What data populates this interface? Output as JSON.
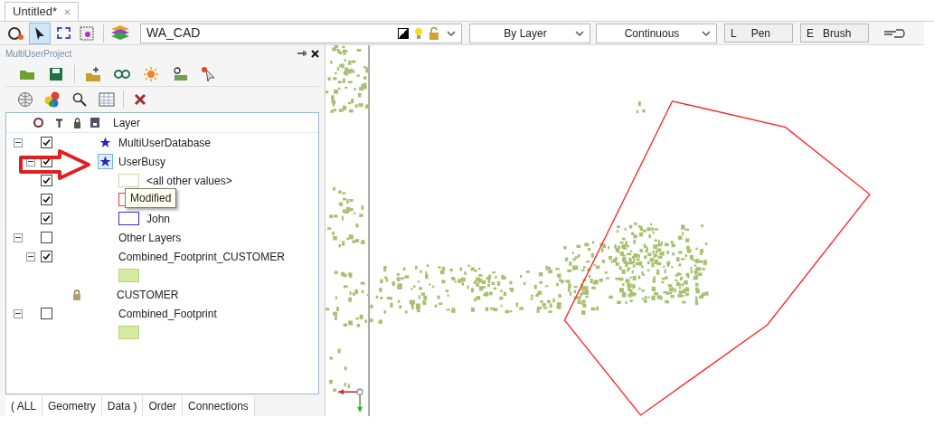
{
  "document_tabs": [
    {
      "label": "Untitled*",
      "selected": true
    }
  ],
  "toolbar": {
    "layer_field": "WA_CAD",
    "color_select": "By Layer",
    "linetype_select": "Continuous",
    "pen_button": {
      "key": "L",
      "label": "Pen"
    },
    "brush_button": {
      "key": "E",
      "label": "Brush"
    }
  },
  "panel": {
    "title": "MultiUserProject",
    "column_header": "Layer",
    "layers": [
      {
        "kind": "star_layer",
        "label": "MultiUserDatabase",
        "expanded": true,
        "checked": true,
        "children": [
          {
            "kind": "star_layer",
            "label": "UserBusy",
            "highlighted": true,
            "expanded": true,
            "checked": true,
            "children": [
              {
                "kind": "outline_legend",
                "label": "<all other values>",
                "checked": true,
                "color": "#d8d2a8"
              },
              {
                "kind": "outline_legend",
                "checked": true,
                "color": "#ff3030"
              },
              {
                "kind": "outline_legend",
                "label": "John",
                "checked": true,
                "color": "#3030e0"
              }
            ]
          }
        ]
      },
      {
        "kind": "layer",
        "label": "Other Layers",
        "expanded": true,
        "checked": false,
        "children": [
          {
            "kind": "layer",
            "label": "Combined_Footprint_CUSTOMER",
            "expanded": true,
            "checked": true,
            "children": [
              {
                "kind": "fill_legend",
                "color": "#d6eaa0"
              }
            ]
          }
        ]
      },
      {
        "kind": "group",
        "label": "CUSTOMER",
        "locked": true,
        "children": [
          {
            "kind": "layer",
            "label": "Combined_Footprint",
            "expanded": true,
            "checked": false,
            "children": [
              {
                "kind": "fill_legend",
                "color": "#d6eaa0"
              }
            ]
          }
        ]
      }
    ],
    "tooltip": "Modified",
    "bottom_tabs": [
      "( ALL",
      "Geometry",
      "Data )",
      "Order",
      "Connections"
    ]
  }
}
